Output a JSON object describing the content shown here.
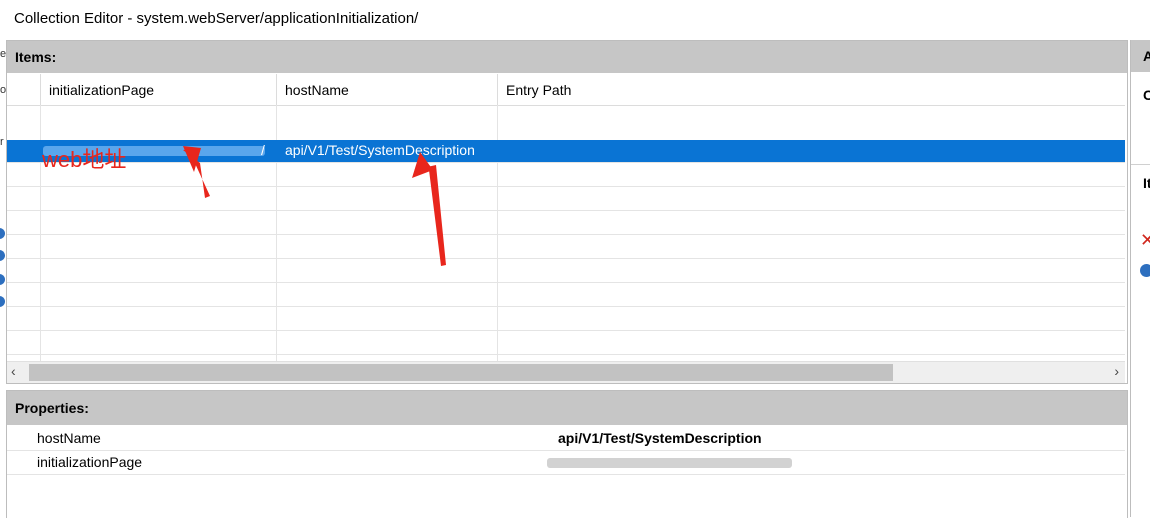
{
  "window": {
    "title": "Collection Editor - system.webServer/applicationInitialization/"
  },
  "items": {
    "header": "Items:",
    "columns": [
      "initializationPage",
      "hostName",
      "Entry Path"
    ],
    "rows": [
      {
        "initializationPage": "/",
        "hostName": "api/V1/Test/SystemDescription",
        "entryPath": ""
      }
    ]
  },
  "properties": {
    "header": "Properties:",
    "rows": [
      {
        "name": "hostName",
        "value": "api/V1/Test/SystemDescription"
      },
      {
        "name": "initializationPage",
        "value": ""
      }
    ]
  },
  "scrollbar": {
    "left_arrow": "‹",
    "right_arrow": "›"
  },
  "right_panel": {
    "header_letter": "A",
    "row1_letter": "C",
    "row2_letter": "It"
  },
  "annotation": {
    "label": "web地址",
    "color": "#e8261c"
  },
  "colors": {
    "selection": "#0a74d4",
    "section_header": "#c6c6c6"
  }
}
